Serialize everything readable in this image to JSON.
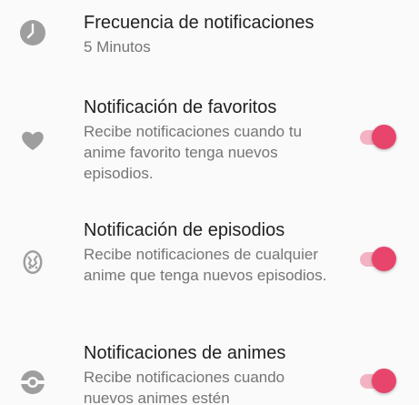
{
  "colors": {
    "background": "#fafafa",
    "title": "#212121",
    "summary": "#757575",
    "icon": "#9e9e9e",
    "switch_thumb": "#e8456c",
    "switch_track": "#f4b3c3"
  },
  "prefs": [
    {
      "title": "Frecuencia de notificaciones",
      "summary": "5 Minutos",
      "icon": "clock-icon"
    },
    {
      "title": "Notificación de favoritos",
      "summary": "Recibe notificaciones cuando tu anime favorito tenga nuevos episodios.",
      "icon": "heart-icon",
      "enabled": true
    },
    {
      "title": "Notificación de episodios",
      "summary": "Recibe notificaciones de cualquier anime que tenga nuevos episodios.",
      "icon": "egg-icon",
      "enabled": true
    },
    {
      "title": "Notificaciones de animes",
      "summary": "Recibe notificaciones cuando nuevos animes estén",
      "icon": "pokeball-icon",
      "enabled": true
    }
  ]
}
